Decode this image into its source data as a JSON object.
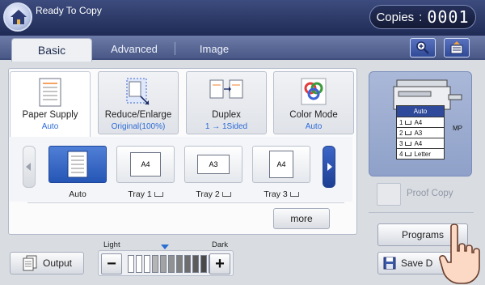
{
  "status": {
    "text": "Ready To Copy"
  },
  "copies": {
    "label": "Copies",
    "separator": ":",
    "value": "0001"
  },
  "tabs": [
    {
      "label": "Basic",
      "active": true
    },
    {
      "label": "Advanced",
      "active": false
    },
    {
      "label": "Image",
      "active": false
    }
  ],
  "functions": [
    {
      "title": "Paper Supply",
      "value": "Auto"
    },
    {
      "title": "Reduce/Enlarge",
      "value": "Original(100%)"
    },
    {
      "title": "Duplex",
      "value": "1 → 1Sided"
    },
    {
      "title": "Color Mode",
      "value": "Auto"
    }
  ],
  "trays": [
    {
      "label": "Auto",
      "paper": "",
      "selected": true
    },
    {
      "label": "Tray 1",
      "paper": "A4",
      "selected": false
    },
    {
      "label": "Tray 2",
      "paper": "A3",
      "selected": false
    },
    {
      "label": "Tray 3",
      "paper": "A4",
      "selected": false
    }
  ],
  "more": {
    "label": "more"
  },
  "output": {
    "label": "Output"
  },
  "density": {
    "light_label": "Light",
    "dark_label": "Dark",
    "minus": "−",
    "plus": "+",
    "levels": 11,
    "current": 6
  },
  "machine": {
    "head": "Auto",
    "rows": [
      {
        "num": "1",
        "paper": "A4"
      },
      {
        "num": "2",
        "paper": "A3"
      },
      {
        "num": "3",
        "paper": "A4"
      },
      {
        "num": "4",
        "paper": "Letter"
      }
    ],
    "mp": "MP"
  },
  "proof_copy": {
    "label": "Proof Copy"
  },
  "programs": {
    "label": "Programs"
  },
  "save": {
    "label": "Save D"
  },
  "colors": {
    "accent": "#2d6bd6",
    "header": "#1f2b55",
    "selected": "#2656b5"
  }
}
